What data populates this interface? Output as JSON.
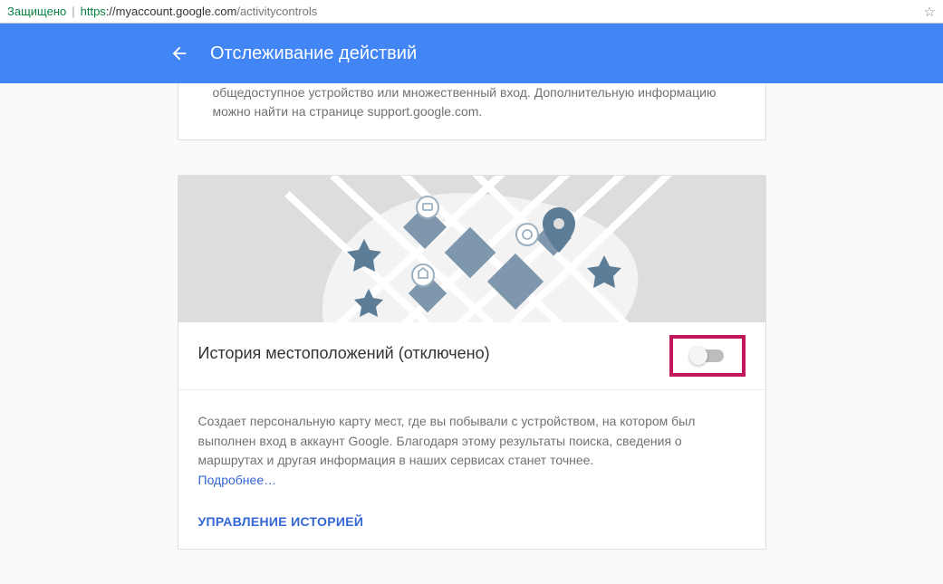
{
  "address_bar": {
    "secure_label": "Защищено",
    "protocol": "https",
    "host": "://myaccount.google.com",
    "path": "/activitycontrols"
  },
  "header": {
    "title": "Отслеживание действий"
  },
  "card1": {
    "text": "общедоступное устройство или множественный вход. Дополнительную информацию можно найти на странице support.google.com."
  },
  "card2": {
    "title": "История местоположений (отключено)",
    "toggle_on": false,
    "description": "Создает персональную карту мест, где вы побывали с устройством, на котором был выполнен вход в аккаунт Google. Благодаря этому результаты поиска, сведения о маршрутах и другая информация в наших сервисах станет точнее.",
    "learn_more": "Подробнее…",
    "manage": "УПРАВЛЕНИЕ ИСТОРИЕЙ"
  }
}
